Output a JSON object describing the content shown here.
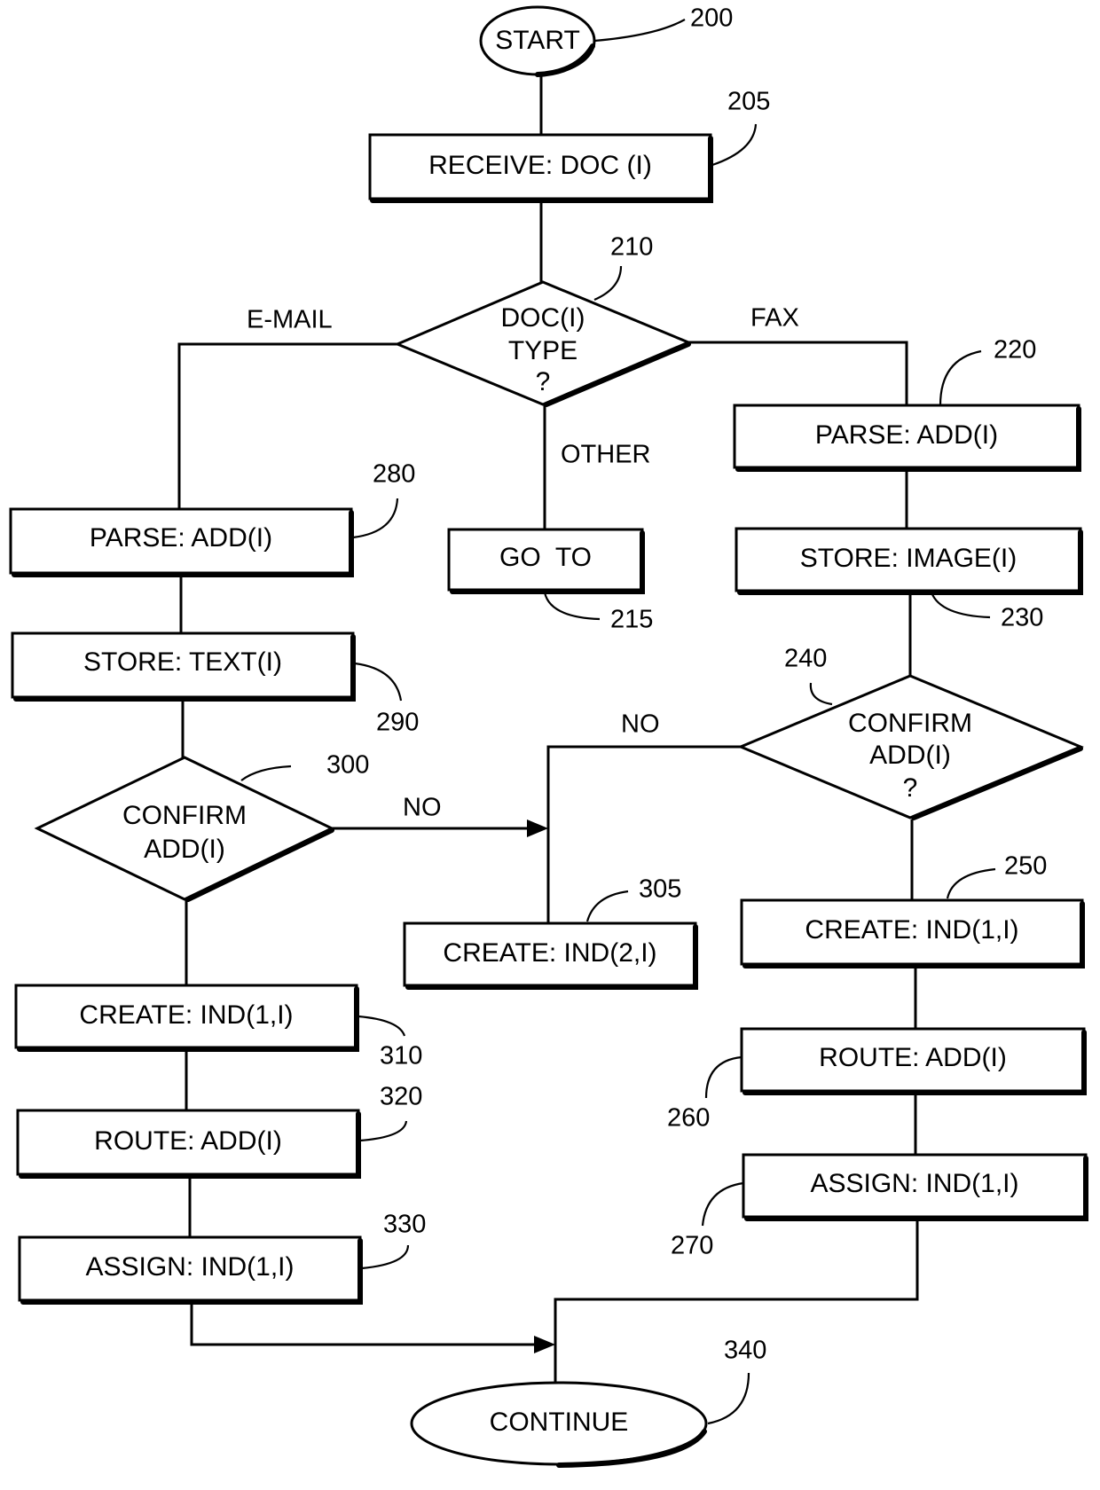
{
  "diagram": {
    "type": "flowchart",
    "nodes": {
      "n200": {
        "ref": "200",
        "shape": "terminator",
        "lines": [
          "START"
        ]
      },
      "n205": {
        "ref": "205",
        "shape": "process",
        "lines": [
          "RECEIVE: DOC (I)"
        ]
      },
      "n210": {
        "ref": "210",
        "shape": "decision",
        "lines": [
          "DOC(I)",
          "TYPE",
          "?"
        ]
      },
      "n215": {
        "ref": "215",
        "shape": "process",
        "lines": [
          "GO  TO"
        ]
      },
      "n220": {
        "ref": "220",
        "shape": "process",
        "lines": [
          "PARSE: ADD(I)"
        ]
      },
      "n230": {
        "ref": "230",
        "shape": "process",
        "lines": [
          "STORE: IMAGE(I)"
        ]
      },
      "n240": {
        "ref": "240",
        "shape": "decision",
        "lines": [
          "CONFIRM",
          "ADD(I)",
          "?"
        ]
      },
      "n250": {
        "ref": "250",
        "shape": "process",
        "lines": [
          "CREATE: IND(1,I)"
        ]
      },
      "n260": {
        "ref": "260",
        "shape": "process",
        "lines": [
          "ROUTE: ADD(I)"
        ]
      },
      "n270": {
        "ref": "270",
        "shape": "process",
        "lines": [
          "ASSIGN: IND(1,I)"
        ]
      },
      "n280": {
        "ref": "280",
        "shape": "process",
        "lines": [
          "PARSE: ADD(I)"
        ]
      },
      "n290": {
        "ref": "290",
        "shape": "process",
        "lines": [
          "STORE: TEXT(I)"
        ]
      },
      "n300": {
        "ref": "300",
        "shape": "decision",
        "lines": [
          "CONFIRM",
          "ADD(I)"
        ]
      },
      "n305": {
        "ref": "305",
        "shape": "process",
        "lines": [
          "CREATE: IND(2,I)"
        ]
      },
      "n310": {
        "ref": "310",
        "shape": "process",
        "lines": [
          "CREATE: IND(1,I)"
        ]
      },
      "n320": {
        "ref": "320",
        "shape": "process",
        "lines": [
          "ROUTE: ADD(I)"
        ]
      },
      "n330": {
        "ref": "330",
        "shape": "process",
        "lines": [
          "ASSIGN: IND(1,I)"
        ]
      },
      "n340": {
        "ref": "340",
        "shape": "terminator",
        "lines": [
          "CONTINUE"
        ]
      }
    },
    "branch_labels": {
      "email": "E-MAIL",
      "fax": "FAX",
      "other": "OTHER",
      "no_240": "NO",
      "no_300": "NO"
    },
    "edges": [
      {
        "from": "200",
        "to": "205"
      },
      {
        "from": "205",
        "to": "210"
      },
      {
        "from": "210",
        "to": "280",
        "label": "E-MAIL"
      },
      {
        "from": "210",
        "to": "220",
        "label": "FAX"
      },
      {
        "from": "210",
        "to": "215",
        "label": "OTHER"
      },
      {
        "from": "220",
        "to": "230"
      },
      {
        "from": "230",
        "to": "240"
      },
      {
        "from": "240",
        "to": "305",
        "label": "NO"
      },
      {
        "from": "240",
        "to": "250"
      },
      {
        "from": "250",
        "to": "260"
      },
      {
        "from": "260",
        "to": "270"
      },
      {
        "from": "270",
        "to": "340"
      },
      {
        "from": "280",
        "to": "290"
      },
      {
        "from": "290",
        "to": "300"
      },
      {
        "from": "300",
        "to": "305",
        "label": "NO"
      },
      {
        "from": "300",
        "to": "310"
      },
      {
        "from": "310",
        "to": "320"
      },
      {
        "from": "320",
        "to": "330"
      },
      {
        "from": "330",
        "to": "340"
      }
    ]
  }
}
